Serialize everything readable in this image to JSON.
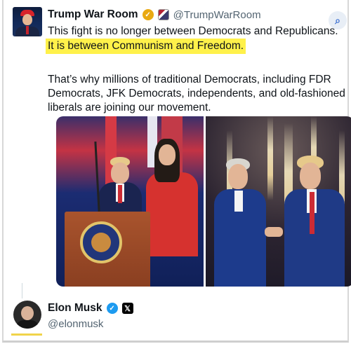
{
  "tweet": {
    "author_name": "Trump War Room",
    "handle": "@TrumpWarRoom",
    "verified_icon": "gold-check-icon",
    "affiliation_icon": "affiliate-badge-icon",
    "line1": "This fight is no longer between Democrats and Republicans.",
    "line2_highlighted": "It is between Communism and Freedom.",
    "para2_line1": "That’s why millions of traditional Democrats, including FDR",
    "para2_line2": "Democrats, JFK Democrats, independents, and old-fashioned",
    "para2_line3": "liberals are joining our movement.",
    "highlight_color": "#fff14a"
  },
  "reply": {
    "author_name": "Elon Musk",
    "handle": "@elonmusk",
    "verified_icon": "blue-check-icon",
    "affiliation_icon": "x-logo-icon"
  },
  "toolbar": {
    "lens_icon": "visual-search-icon"
  },
  "colors": {
    "text": "#0f1419",
    "secondary": "#536471",
    "verified_gold": "#e9a912",
    "verified_blue": "#1d9bf0"
  }
}
